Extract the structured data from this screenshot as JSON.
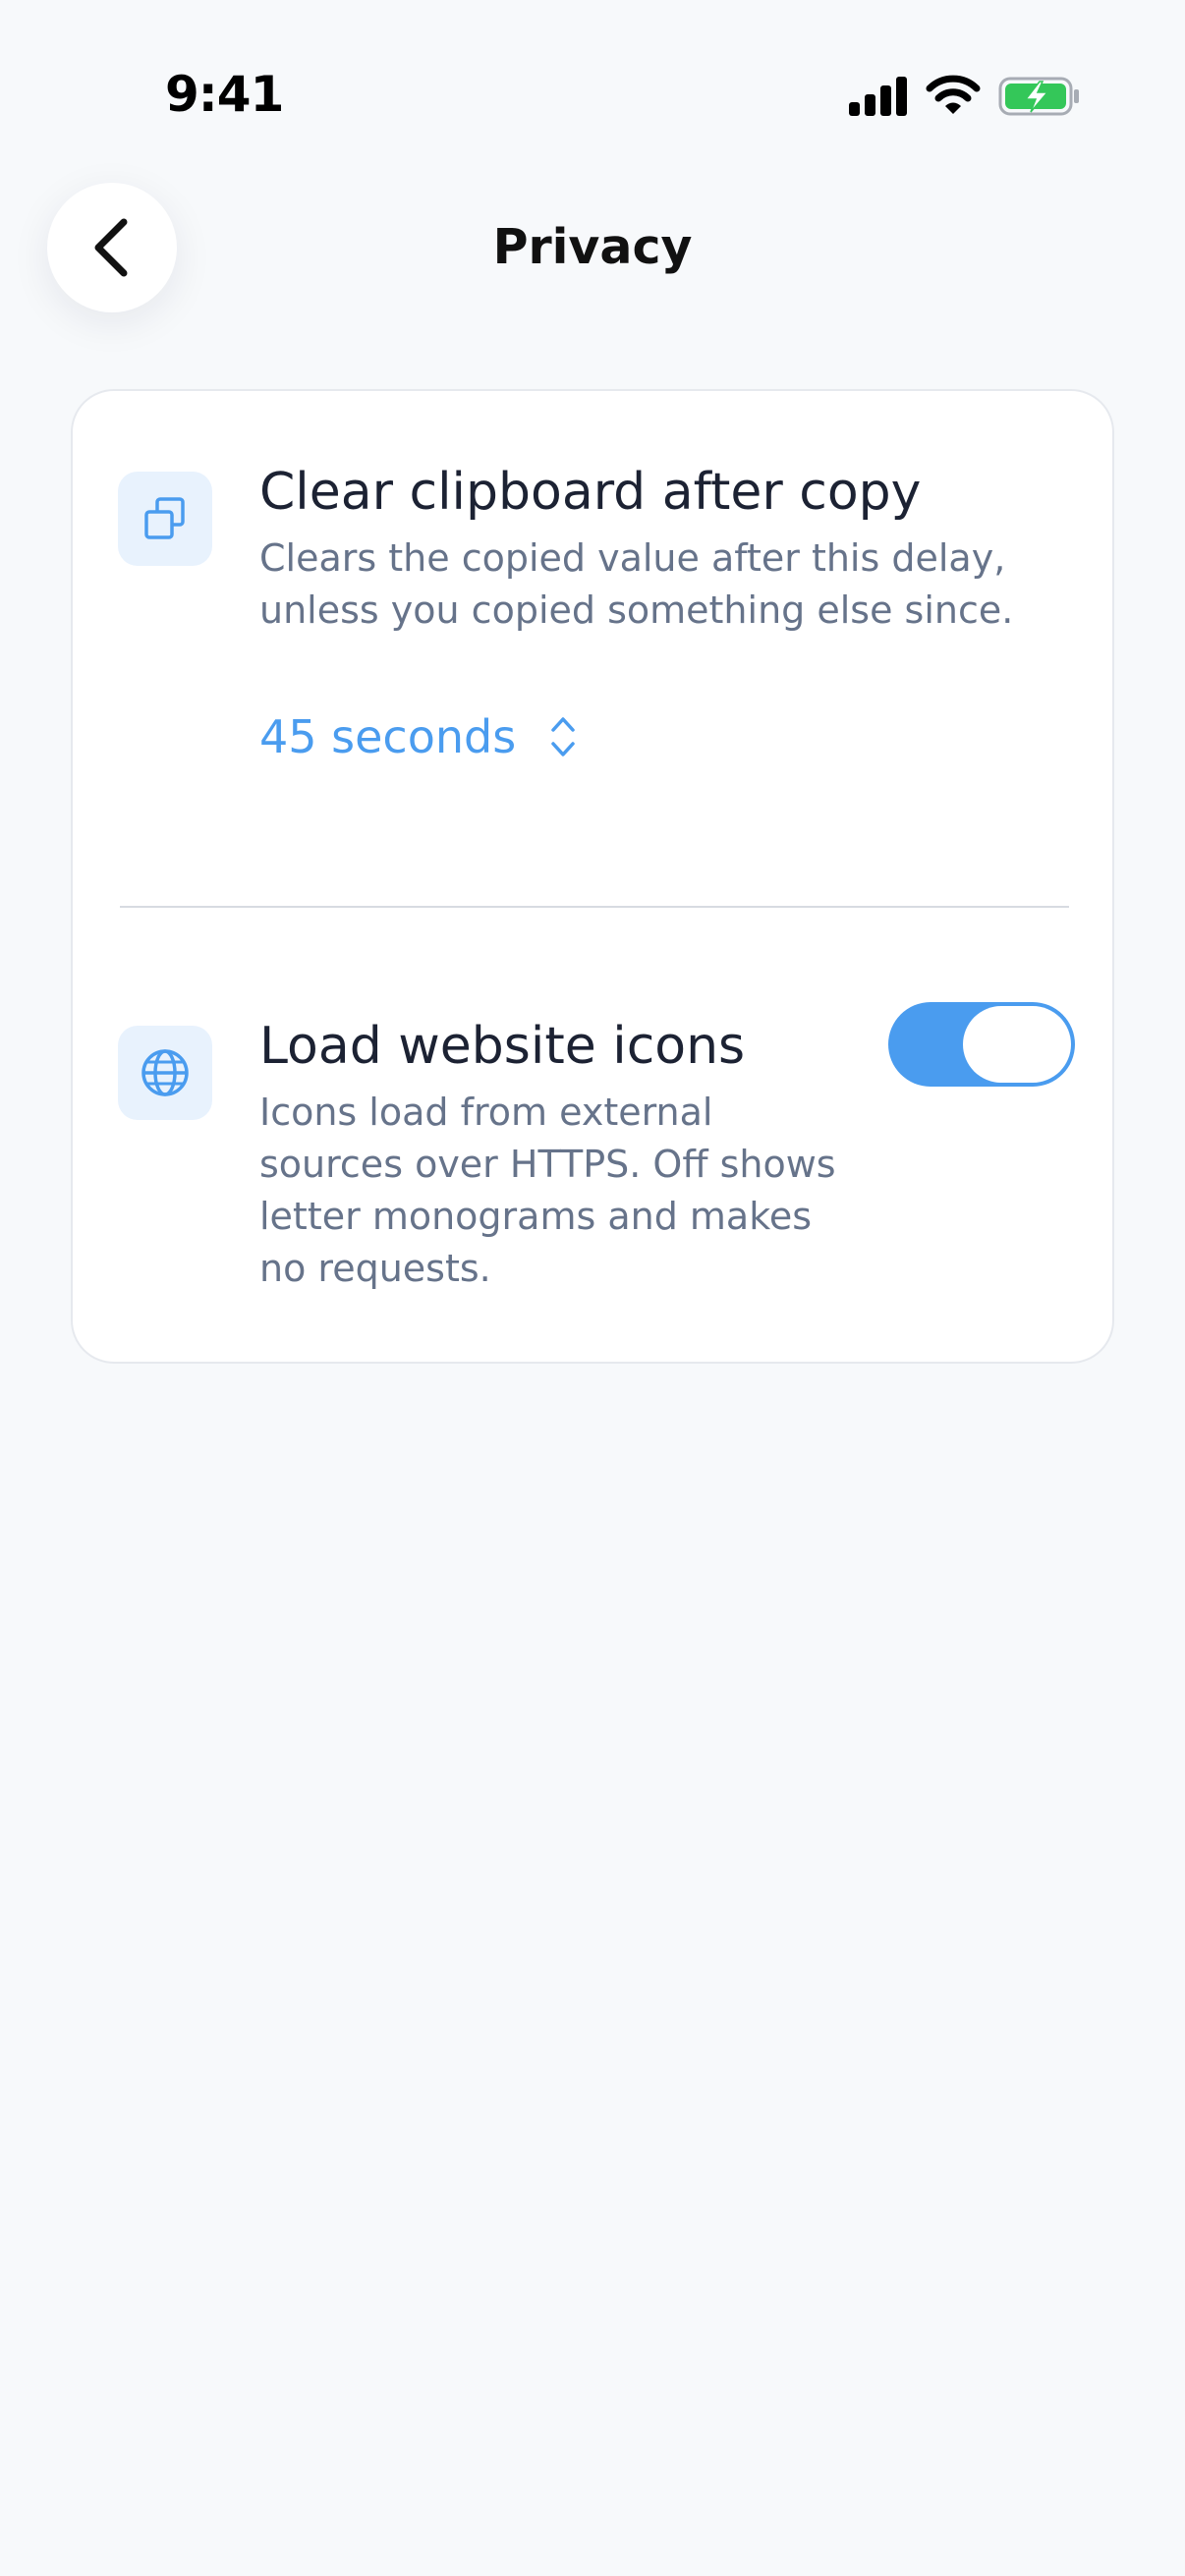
{
  "status_bar": {
    "time": "9:41",
    "icons": [
      "signal-icon",
      "wifi-icon",
      "battery-charging-icon"
    ]
  },
  "header": {
    "title": "Privacy",
    "back_icon": "chevron-left-icon"
  },
  "settings": {
    "clipboard": {
      "icon": "copy-icon",
      "title": "Clear clipboard after copy",
      "description_line1": "Clears the copied value after this delay,",
      "description_line2": "unless you copied something else since.",
      "selected_value": "45 seconds",
      "selector_icon": "chevron-up-down-icon"
    },
    "website_icons": {
      "icon": "globe-icon",
      "title": "Load website icons",
      "description_line1": "Icons load from external",
      "description_line2": "sources over HTTPS. Off shows",
      "description_line3": "letter monograms and makes",
      "description_line4": "no requests.",
      "enabled": true
    }
  },
  "colors": {
    "accent": "#4a9cef",
    "background": "#f7f9fb",
    "card": "#ffffff",
    "icon_tile": "#e8f2fd",
    "battery_green": "#34c759",
    "secondary_text": "#66738a"
  }
}
